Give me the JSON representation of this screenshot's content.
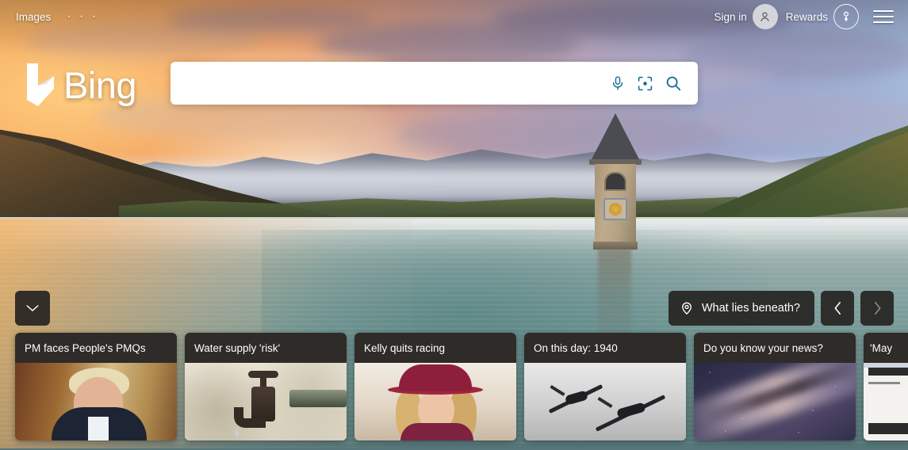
{
  "topnav": {
    "links": [
      {
        "label": "Images",
        "name": "nav-link-images"
      }
    ],
    "more_label": "· · ·",
    "signin_label": "Sign in",
    "rewards_label": "Rewards",
    "menu_name": "hamburger-menu"
  },
  "brand": {
    "name": "Bing"
  },
  "search": {
    "value": "",
    "placeholder": "",
    "mic_icon": "microphone-icon",
    "visual_icon": "visual-search-icon",
    "search_icon": "search-icon"
  },
  "hero": {
    "scroll_down_icon": "chevron-down-icon",
    "beneath_label": "What lies beneath?",
    "beneath_icon": "location-pin-icon",
    "prev_icon": "chevron-left-icon",
    "next_icon": "chevron-right-icon"
  },
  "cards": [
    {
      "title": "PM faces People's PMQs",
      "image": "portrait-politician"
    },
    {
      "title": "Water supply 'risk'",
      "image": "water-tap"
    },
    {
      "title": "Kelly quits racing",
      "image": "woman-red-hat"
    },
    {
      "title": "On this day: 1940",
      "image": "wwii-aircraft-bw"
    },
    {
      "title": "Do you know your news?",
      "image": "milky-way-galaxy"
    },
    {
      "title": "'May",
      "image": "newspaper-clipping"
    }
  ],
  "colors": {
    "accent_teal": "#0f6e91",
    "card_header": "#2e2b29",
    "overlay_dark": "rgba(38,36,34,0.92)"
  }
}
